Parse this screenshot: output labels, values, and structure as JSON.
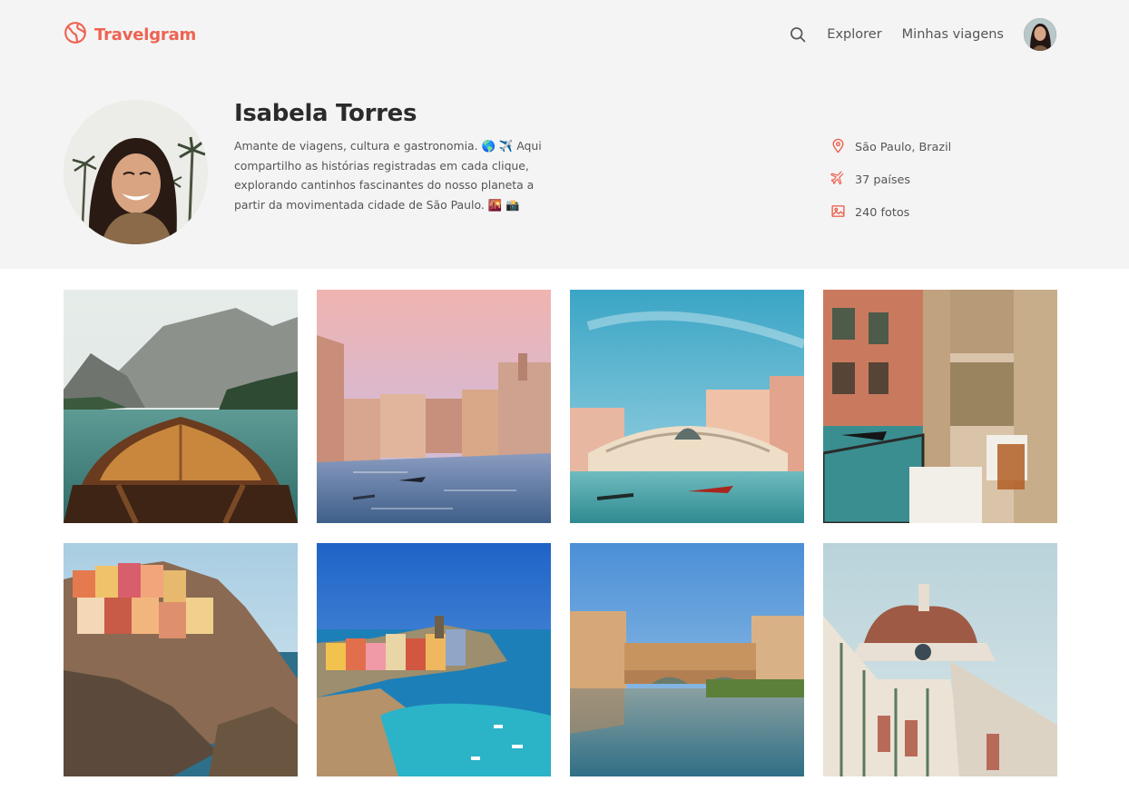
{
  "header": {
    "brand": "Travelgram",
    "nav_links": [
      "Explorer",
      "Minhas viagens"
    ]
  },
  "profile": {
    "name": "Isabela Torres",
    "bio": "Amante de viagens, cultura e gastronomia. 🌎 ✈️ Aqui compartilho as histórias registradas em cada clique, explorando cantinhos fascinantes do nosso planeta a partir da movimentada cidade de São Paulo. 🌇 📸",
    "stats": {
      "location": "São Paulo, Brazil",
      "countries": "37 países",
      "photos": "240 fotos"
    }
  },
  "icons": {
    "brand": "globe-icon",
    "search": "search-icon",
    "location": "location-pin-icon",
    "countries": "plane-icon",
    "photos": "image-icon"
  },
  "colors": {
    "accent": "#ee6352",
    "header_background": "#f4f4f4",
    "text_primary": "#2b2b2b",
    "text_secondary": "#555555"
  }
}
